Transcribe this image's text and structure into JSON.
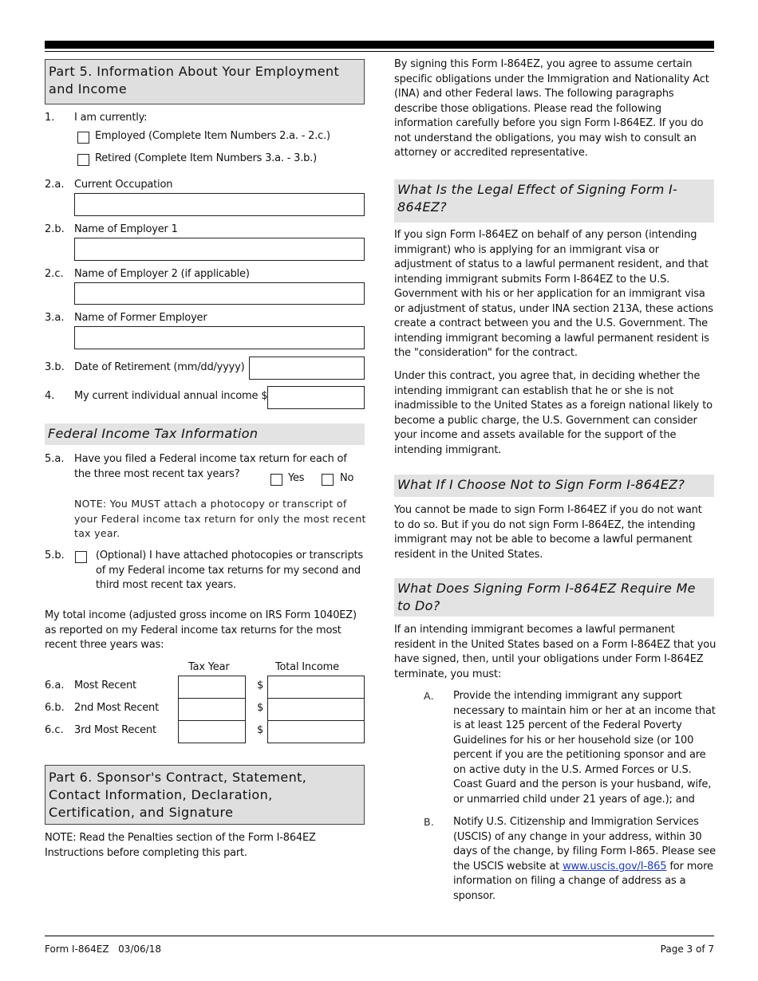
{
  "part5": {
    "title": "Part 5.  Information About Your Employment and Income",
    "item1": {
      "num": "1.",
      "label": "I am currently:",
      "options": [
        {
          "label": "Employed (Complete Item Numbers 2.a. - 2.c.)"
        },
        {
          "label": "Retired (Complete Item Numbers 3.a. - 3.b.)"
        }
      ]
    },
    "fields": [
      {
        "num": "2.a.",
        "label": "Current Occupation",
        "value": ""
      },
      {
        "num": "2.b.",
        "label": "Name of Employer 1",
        "value": ""
      },
      {
        "num": "2.c.",
        "label": "Name of Employer 2 (if applicable)",
        "value": ""
      },
      {
        "num": "3.a.",
        "label": "Name of Former Employer",
        "value": ""
      }
    ],
    "item3b": {
      "num": "3.b.",
      "label": "Date of Retirement (mm/dd/yyyy)",
      "value": ""
    },
    "item4": {
      "num": "4.",
      "label": "My current individual annual income $",
      "value": ""
    },
    "federal": {
      "title": "Federal Income Tax Information",
      "item5a": {
        "num": "5.a.",
        "label": "Have you filed a Federal income tax return for each of the three most recent tax years?",
        "yes": "Yes",
        "no": "No"
      },
      "note": "NOTE:  You MUST attach a photocopy or transcript of your Federal income tax return for only the most recent tax year.",
      "item5b": {
        "num": "5.b.",
        "label": "(Optional) I have attached photocopies or transcripts of my Federal income tax returns for my second and third most recent tax years."
      },
      "total_intro": "My total income (adjusted gross income on IRS Form 1040EZ) as reported on my Federal income tax returns for the most recent three years was:",
      "col_tax_year": "Tax Year",
      "col_total_income": "Total Income",
      "currency": "$",
      "rows": [
        {
          "num": "6.a.",
          "label": "Most Recent",
          "tax_year": "",
          "income": ""
        },
        {
          "num": "6.b.",
          "label": "2nd Most Recent",
          "tax_year": "",
          "income": ""
        },
        {
          "num": "6.c.",
          "label": "3rd Most Recent",
          "tax_year": "",
          "income": ""
        }
      ]
    }
  },
  "part6": {
    "title": "Part 6.  Sponsor's Contract, Statement, Contact Information, Declaration, Certification, and Signature",
    "note": "NOTE:  Read the Penalties section of the Form I-864EZ Instructions before completing this part."
  },
  "right": {
    "intro": "By signing this Form I-864EZ, you agree to assume certain specific obligations under the Immigration and Nationality Act (INA) and other Federal laws.  The following paragraphs describe those obligations.  Please read the following information carefully before you sign Form I-864EZ.  If you do not understand the obligations, you may wish to consult an attorney or accredited representative.",
    "sec1": {
      "title": "What Is the Legal Effect of Signing Form I-864EZ?",
      "p1": "If you sign Form I-864EZ on behalf of any person (intending immigrant) who is applying for an immigrant visa or adjustment of status to a lawful permanent resident, and that intending immigrant submits Form I-864EZ to the U.S. Government with his or her application for an immigrant visa or adjustment of status, under INA section 213A, these actions create a contract between you and the U.S. Government.  The intending immigrant becoming a lawful permanent resident is the \"consideration\" for the contract.",
      "p2": "Under this contract, you agree that, in deciding whether the intending immigrant can establish that he or she is not inadmissible to the United States as a foreign national likely to become a public charge, the U.S. Government can consider your income and assets available for the support of the intending immigrant."
    },
    "sec2": {
      "title": "What If I Choose Not to Sign Form I-864EZ?",
      "p1": "You cannot be made to sign Form I-864EZ if you do not want to do so.  But if you do not sign Form I-864EZ, the intending immigrant may not be able to become a lawful permanent resident in the United States."
    },
    "sec3": {
      "title": "What Does Signing Form I-864EZ Require Me to Do?",
      "p1": "If an intending immigrant becomes a lawful permanent resident in the United States based on a Form I-864EZ that you have signed, then, until your obligations under Form I-864EZ terminate, you must:",
      "items": [
        {
          "letter": "A.",
          "text": "Provide the intending immigrant any support necessary to maintain him or her at an income that is at least 125 percent of the Federal Poverty Guidelines for his or her household size (or 100 percent if you are the petitioning sponsor and are on active duty in the U.S. Armed Forces or U.S. Coast Guard and the person is your husband, wife, or unmarried child under 21 years of age.); and"
        },
        {
          "letter": "B.",
          "text_before": "Notify U.S. Citizenship and Immigration Services (USCIS) of any change in your address, within 30 days of the change, by filing Form I-865.  Please see the USCIS website at ",
          "link": "www.uscis.gov/I-865",
          "text_after": " for more information on filing a change of address as a sponsor."
        }
      ]
    }
  },
  "footer": {
    "form_id": "Form I-864EZ   03/06/18",
    "page": "Page 3 of 7"
  },
  "colors": {
    "header_bg": "#dfdfdf",
    "link": "#1a3ad6"
  }
}
